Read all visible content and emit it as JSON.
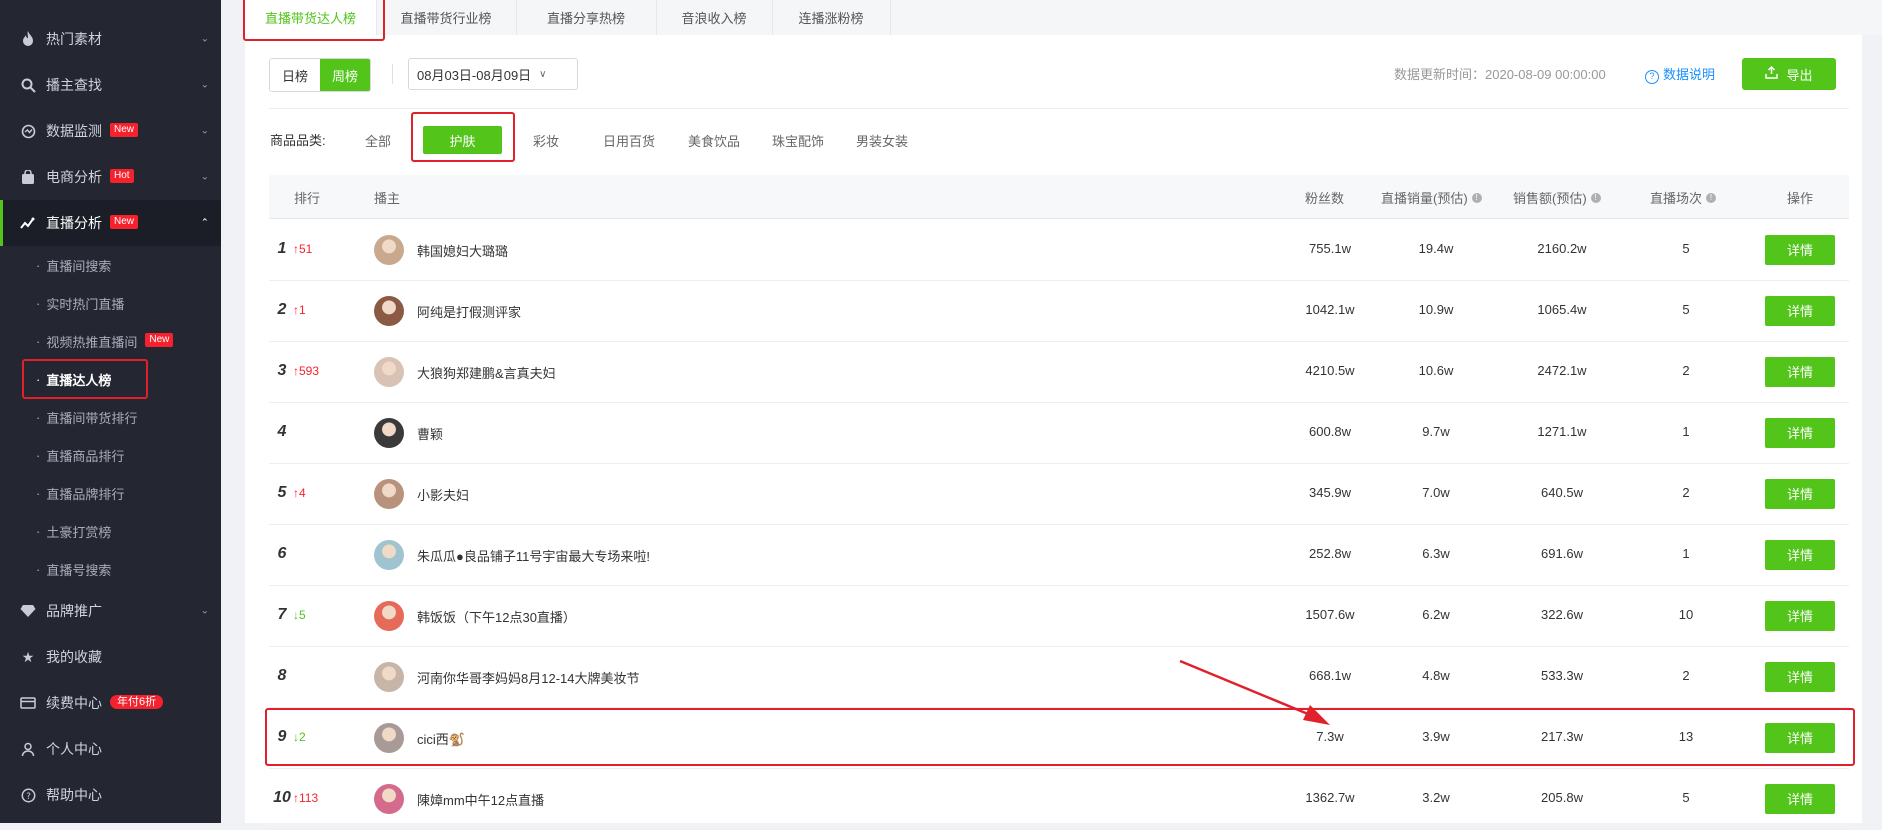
{
  "sidebar": {
    "items": [
      {
        "label": "热门素材",
        "icon": "flame-icon"
      },
      {
        "label": "播主查找",
        "icon": "search-icon"
      },
      {
        "label": "数据监测",
        "icon": "monitor-icon",
        "badge": "New"
      },
      {
        "label": "电商分析",
        "icon": "shopping-bag-icon",
        "badge": "Hot"
      },
      {
        "label": "直播分析",
        "icon": "live-trend-icon",
        "badge": "New"
      }
    ],
    "sub_items": [
      "直播间搜索",
      "实时热门直播",
      "视频热推直播间",
      "直播达人榜",
      "直播间带货排行",
      "直播商品排行",
      "直播品牌排行",
      "土豪打赏榜",
      "直播号搜索"
    ],
    "sub_badge": "New",
    "bottom_items": [
      {
        "label": "品牌推广",
        "icon": "diamond-icon"
      },
      {
        "label": "我的收藏",
        "icon": "star-icon"
      },
      {
        "label": "续费中心",
        "icon": "card-icon",
        "badge": "年付6折"
      },
      {
        "label": "个人中心",
        "icon": "user-icon"
      },
      {
        "label": "帮助中心",
        "icon": "help-icon"
      }
    ]
  },
  "tabs": [
    "直播带货达人榜",
    "直播带货行业榜",
    "直播分享热榜",
    "音浪收入榜",
    "连播涨粉榜"
  ],
  "toolbar": {
    "day_label": "日榜",
    "week_label": "周榜",
    "date_range": "08月03日-08月09日",
    "update_time": "数据更新时间：2020-08-09 00:00:00",
    "help_label": "数据说明",
    "export_label": "导出"
  },
  "category": {
    "label": "商品品类:",
    "options": [
      "全部",
      "护肤",
      "彩妆",
      "日用百货",
      "美食饮品",
      "珠宝配饰",
      "男装女装"
    ],
    "selected": "护肤"
  },
  "table": {
    "headers": {
      "rank": "排行",
      "anchor": "播主",
      "fans": "粉丝数",
      "sales": "直播销量(预估)",
      "gmv": "销售额(预估)",
      "sessions": "直播场次",
      "action": "操作"
    },
    "action_label": "详情",
    "rows": [
      {
        "rank": "1",
        "change": "↑51",
        "dir": "up",
        "name": "韩国媳妇大璐璐",
        "fans": "755.1w",
        "sales": "19.4w",
        "gmv": "2160.2w",
        "sessions": "5"
      },
      {
        "rank": "2",
        "change": "↑1",
        "dir": "up",
        "name": "阿纯是打假测评家",
        "fans": "1042.1w",
        "sales": "10.9w",
        "gmv": "1065.4w",
        "sessions": "5"
      },
      {
        "rank": "3",
        "change": "↑593",
        "dir": "up",
        "name": "大狼狗郑建鹏&言真夫妇",
        "fans": "4210.5w",
        "sales": "10.6w",
        "gmv": "2472.1w",
        "sessions": "2"
      },
      {
        "rank": "4",
        "change": "",
        "dir": "",
        "name": "曹颖",
        "fans": "600.8w",
        "sales": "9.7w",
        "gmv": "1271.1w",
        "sessions": "1"
      },
      {
        "rank": "5",
        "change": "↑4",
        "dir": "up",
        "name": "小影夫妇",
        "fans": "345.9w",
        "sales": "7.0w",
        "gmv": "640.5w",
        "sessions": "2"
      },
      {
        "rank": "6",
        "change": "",
        "dir": "",
        "name": "朱瓜瓜●良品铺子11号宇宙最大专场来啦!",
        "fans": "252.8w",
        "sales": "6.3w",
        "gmv": "691.6w",
        "sessions": "1"
      },
      {
        "rank": "7",
        "change": "↓5",
        "dir": "down",
        "name": "韩饭饭（下午12点30直播）",
        "fans": "1507.6w",
        "sales": "6.2w",
        "gmv": "322.6w",
        "sessions": "10"
      },
      {
        "rank": "8",
        "change": "",
        "dir": "",
        "name": "河南你华哥李妈妈8月12-14大牌美妆节",
        "fans": "668.1w",
        "sales": "4.8w",
        "gmv": "533.3w",
        "sessions": "2"
      },
      {
        "rank": "9",
        "change": "↓2",
        "dir": "down",
        "name": "cici西🐒",
        "fans": "7.3w",
        "sales": "3.9w",
        "gmv": "217.3w",
        "sessions": "13"
      },
      {
        "rank": "10",
        "change": "↑113",
        "dir": "up",
        "name": "陳嫜mm中午12点直播",
        "fans": "1362.7w",
        "sales": "3.2w",
        "gmv": "205.8w",
        "sessions": "5"
      }
    ]
  },
  "colors": {
    "accent": "#52c41a",
    "highlight": "#e0212b",
    "sidebar_bg": "#242632",
    "up": "#f5222d",
    "down": "#52c41a"
  }
}
